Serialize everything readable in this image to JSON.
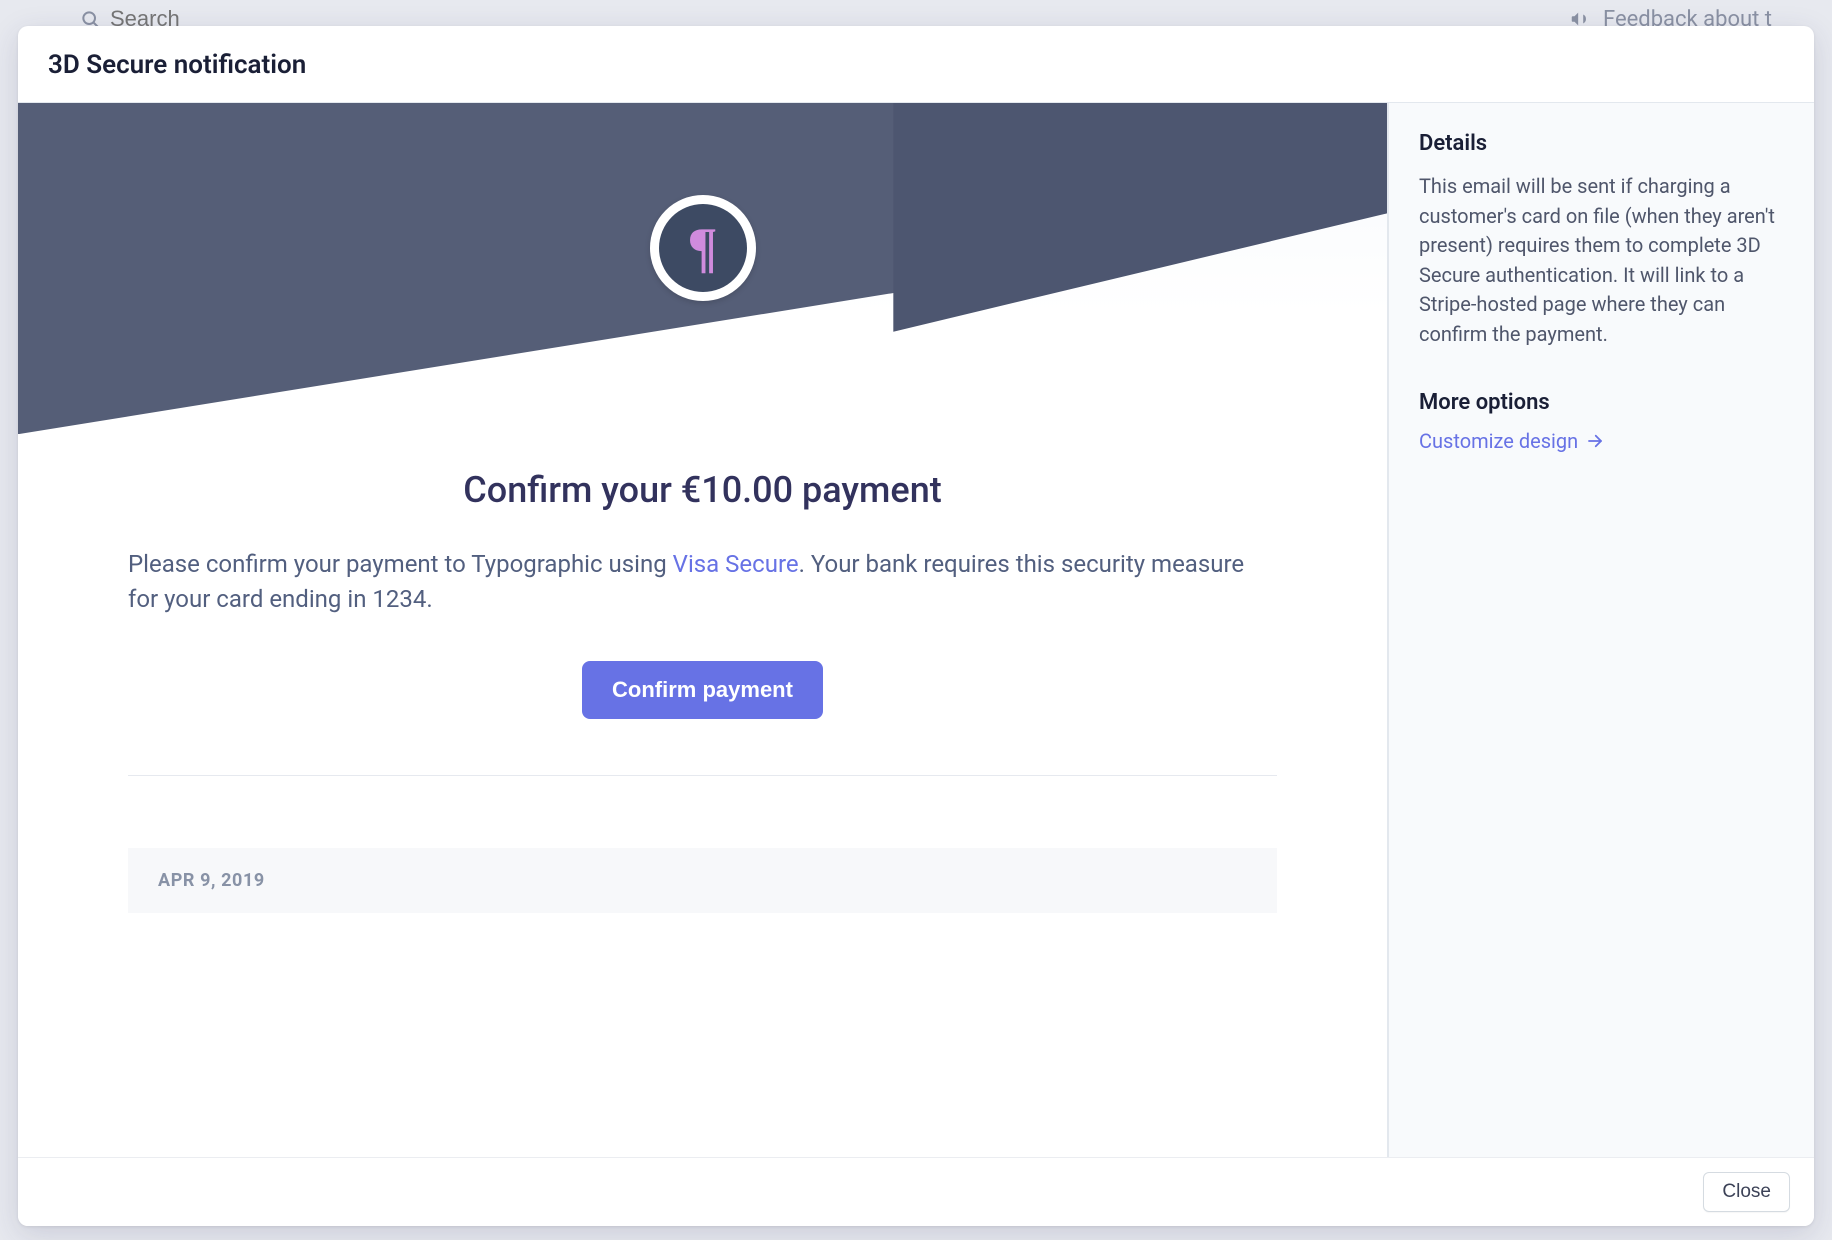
{
  "topbar": {
    "search_placeholder": "Search",
    "feedback_label": "Feedback about t"
  },
  "modal": {
    "title": "3D Secure notification",
    "close_label": "Close"
  },
  "email": {
    "logo_glyph": "¶",
    "heading": "Confirm your €10.00 payment",
    "body_prefix": "Please confirm your payment to Typographic using ",
    "body_link": "Visa Secure",
    "body_suffix": ". Your bank requires this security measure for your card ending in 1234.",
    "cta": "Confirm payment",
    "date": "APR 9, 2019"
  },
  "details": {
    "heading": "Details",
    "body": "This email will be sent if charging a customer's card on file (when they aren't present) requires them to complete 3D Secure authentication. It will link to a Stripe-hosted page where they can confirm the payment.",
    "more_heading": "More options",
    "customize_label": "Customize design"
  }
}
